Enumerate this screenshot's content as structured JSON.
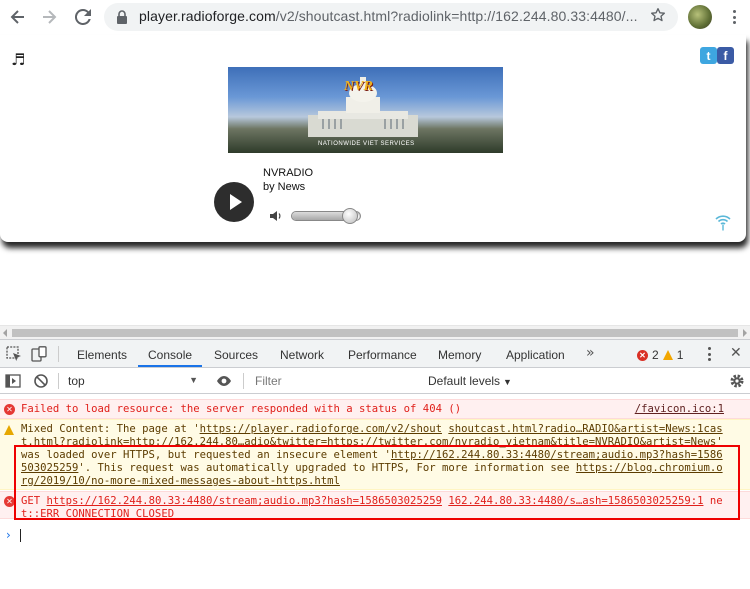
{
  "browser": {
    "url_host": "player.radioforge.com",
    "url_path": "/v2/shoutcast.html?radiolink=http://162.244.80.33:4480/..."
  },
  "player": {
    "station_name": "NVRADIO",
    "station_by": "by News",
    "banner_logo_text": "NVR",
    "banner_tagline": "NATIONWIDE VIET SERVICES",
    "volume_level_percent": 85,
    "social": {
      "twitter_glyph": "t",
      "facebook_glyph": "f"
    }
  },
  "devtools": {
    "tabs": [
      "Elements",
      "Console",
      "Sources",
      "Network",
      "Performance",
      "Memory",
      "Application"
    ],
    "active_tab": "Console",
    "more_tabs_glyph": "»",
    "error_count": "2",
    "warning_count": "1",
    "context_select": "top",
    "filter_placeholder": "Filter",
    "levels_label": "Default levels"
  },
  "console": {
    "messages": [
      {
        "level": "error",
        "text": "Failed to load resource: the server responded with a status of 404 ()",
        "source": "/favicon.ico:1"
      },
      {
        "level": "warning",
        "text_1": "Mixed Content: The page at '",
        "link_1": "https://player.radioforge.com/v2/shout",
        "source_1": "shoutcast.html?radio…RADIO&artist=News:1",
        "text_2_link": "cast.html?radiolink=http://162.244.80…adio&twitter=https://twitter.com/nvradio_vietnam&title=NVRADIO&artist=News",
        "text_3": "' was loaded over HTTPS, but requested an insecure element '",
        "link_2": "http://162.244.80.33:4480/stream;audio.mp3?hash=1586503025259",
        "text_4": "'. This request was automatically upgraded to HTTPS, For more information see ",
        "link_3": "https://blog.chromium.org/2019/10/no-more-mixed-messages-about-https.html"
      },
      {
        "level": "error",
        "prefix": "GET ",
        "link": "https://162.244.80.33:4480/stream;audio.mp3?hash=1586503025259",
        "source": "162.244.80.33:4480/s…ash=1586503025259:1",
        "trailing": "net::ERR_CONNECTION_CLOSED"
      }
    ]
  },
  "colors": {
    "error_text": "#e0201b",
    "warning_bg": "#fffbe5",
    "accent_blue": "#1a73e8",
    "highlight_box": "#ee0000"
  }
}
